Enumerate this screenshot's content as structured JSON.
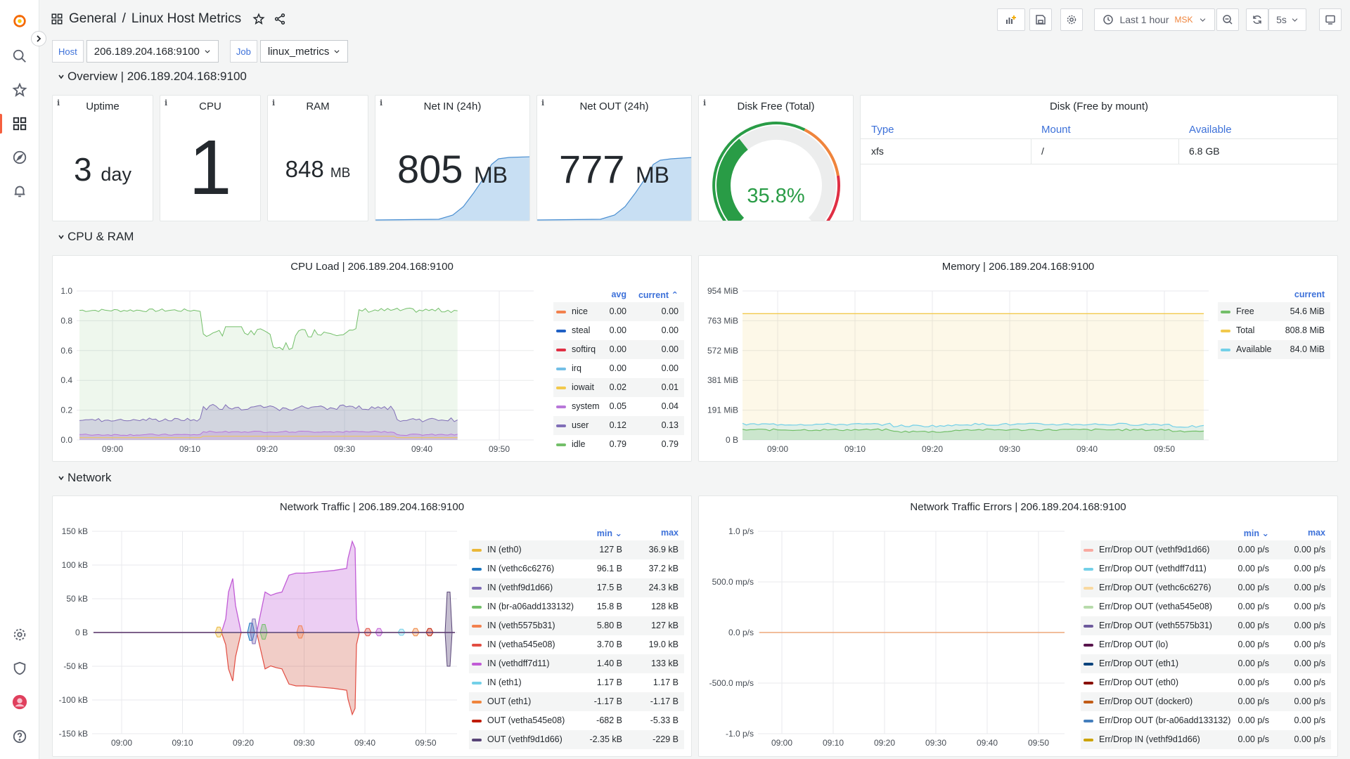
{
  "breadcrumb": {
    "folder": "General",
    "separator": "/",
    "dashboard": "Linux Host Metrics"
  },
  "toolbar": {
    "time_range": "Last 1 hour",
    "timezone": "MSK",
    "refresh_interval": "5s"
  },
  "variables": [
    {
      "label": "Host",
      "value": "206.189.204.168:9100"
    },
    {
      "label": "Job",
      "value": "linux_metrics"
    }
  ],
  "rows": {
    "overview": "Overview | 206.189.204.168:9100",
    "cpu_ram": "CPU & RAM",
    "network": "Network"
  },
  "stats": {
    "uptime": {
      "title": "Uptime",
      "value": "3",
      "unit": "day"
    },
    "cpu": {
      "title": "CPU",
      "value": "1"
    },
    "ram": {
      "title": "RAM",
      "value": "848",
      "unit": "MB"
    },
    "net_in": {
      "title": "Net IN (24h)",
      "value": "805",
      "unit": "MB"
    },
    "net_out": {
      "title": "Net OUT (24h)",
      "value": "777",
      "unit": "MB"
    },
    "disk_free": {
      "title": "Disk Free (Total)",
      "value": "35.8%",
      "fraction": 0.358,
      "color": "#299c46"
    }
  },
  "disk_table": {
    "title": "Disk (Free by mount)",
    "headers": [
      "Type",
      "Mount",
      "Available"
    ],
    "rows": [
      [
        "xfs",
        "/",
        "6.8 GB"
      ]
    ]
  },
  "chart_data": [
    {
      "id": "cpu",
      "type": "area",
      "title": "CPU Load | 206.189.204.168:9100",
      "x": [
        "09:00",
        "09:10",
        "09:20",
        "09:30",
        "09:40",
        "09:50"
      ],
      "yticks": [
        "0.0",
        "0.2",
        "0.4",
        "0.6",
        "0.8",
        "1.0"
      ],
      "ylim": [
        0,
        1
      ],
      "legend_headers": [
        "avg",
        "current"
      ],
      "series": [
        {
          "name": "nice",
          "color": "#f2814e",
          "avg": "0.00",
          "current": "0.00"
        },
        {
          "name": "steal",
          "color": "#1f60c4",
          "avg": "0.00",
          "current": "0.00"
        },
        {
          "name": "softirq",
          "color": "#e02f44",
          "avg": "0.00",
          "current": "0.00"
        },
        {
          "name": "irq",
          "color": "#73bfe6",
          "avg": "0.00",
          "current": "0.00"
        },
        {
          "name": "iowait",
          "color": "#f2c94c",
          "avg": "0.02",
          "current": "0.01"
        },
        {
          "name": "system",
          "color": "#b877d9",
          "avg": "0.05",
          "current": "0.04"
        },
        {
          "name": "user",
          "color": "#806eb7",
          "avg": "0.12",
          "current": "0.13"
        },
        {
          "name": "idle",
          "color": "#73bf69",
          "avg": "0.79",
          "current": "0.79"
        }
      ]
    },
    {
      "id": "mem",
      "type": "area",
      "title": "Memory | 206.189.204.168:9100",
      "x": [
        "09:00",
        "09:10",
        "09:20",
        "09:30",
        "09:40",
        "09:50"
      ],
      "yticks": [
        "0 B",
        "191 MiB",
        "381 MiB",
        "572 MiB",
        "763 MiB",
        "954 MiB"
      ],
      "legend_headers": [
        "current"
      ],
      "series": [
        {
          "name": "Free",
          "color": "#73bf69",
          "current": "54.6 MiB"
        },
        {
          "name": "Total",
          "color": "#f2c94c",
          "current": "808.8 MiB"
        },
        {
          "name": "Available",
          "color": "#73d0e8",
          "current": "84.0 MiB"
        }
      ]
    },
    {
      "id": "net",
      "type": "area",
      "title": "Network Traffic | 206.189.204.168:9100",
      "x": [
        "09:00",
        "09:10",
        "09:20",
        "09:30",
        "09:40",
        "09:50"
      ],
      "yticks": [
        "-150 kB",
        "-100 kB",
        "-50 kB",
        "0 B",
        "50 kB",
        "100 kB",
        "150 kB"
      ],
      "legend_headers": [
        "min",
        "max"
      ],
      "series": [
        {
          "name": "IN (eth0)",
          "color": "#eab839",
          "min": "127 B",
          "max": "36.9 kB"
        },
        {
          "name": "IN (vethc6c6276)",
          "color": "#1f78c1",
          "min": "96.1 B",
          "max": "37.2 kB"
        },
        {
          "name": "IN (vethf9d1d66)",
          "color": "#806eb7",
          "min": "17.5 B",
          "max": "24.3 kB"
        },
        {
          "name": "IN (br-a06add133132)",
          "color": "#73bf69",
          "min": "15.8 B",
          "max": "128 kB"
        },
        {
          "name": "IN (veth5575b31)",
          "color": "#f2814e",
          "min": "5.80 B",
          "max": "127 kB"
        },
        {
          "name": "IN (vetha545e08)",
          "color": "#e24d42",
          "min": "3.70 B",
          "max": "19.0 kB"
        },
        {
          "name": "IN (vethdff7d11)",
          "color": "#c15cd6",
          "min": "1.40 B",
          "max": "133 kB"
        },
        {
          "name": "IN (eth1)",
          "color": "#73d0e8",
          "min": "1.17 B",
          "max": "1.17 B"
        },
        {
          "name": "OUT (eth1)",
          "color": "#ef843c",
          "min": "-1.17 B",
          "max": "-1.17 B"
        },
        {
          "name": "OUT (vetha545e08)",
          "color": "#bf1b00",
          "min": "-682 B",
          "max": "-5.33 B"
        },
        {
          "name": "OUT (vethf9d1d66)",
          "color": "#584477",
          "min": "-2.35 kB",
          "max": "-229 B"
        }
      ]
    },
    {
      "id": "err",
      "type": "line",
      "title": "Network Traffic Errors | 206.189.204.168:9100",
      "x": [
        "09:00",
        "09:10",
        "09:20",
        "09:30",
        "09:40",
        "09:50"
      ],
      "yticks": [
        "-1.0 p/s",
        "-500.0 mp/s",
        "0.0 p/s",
        "500.0 mp/s",
        "1.0 p/s"
      ],
      "legend_headers": [
        "min",
        "max"
      ],
      "series": [
        {
          "name": "Err/Drop OUT (vethf9d1d66)",
          "color": "#f9a9a0",
          "min": "0.00 p/s",
          "max": "0.00 p/s"
        },
        {
          "name": "Err/Drop OUT (vethdff7d11)",
          "color": "#73d0e8",
          "min": "0.00 p/s",
          "max": "0.00 p/s"
        },
        {
          "name": "Err/Drop OUT (vethc6c6276)",
          "color": "#f9d9a0",
          "min": "0.00 p/s",
          "max": "0.00 p/s"
        },
        {
          "name": "Err/Drop OUT (vetha545e08)",
          "color": "#b7dbab",
          "min": "0.00 p/s",
          "max": "0.00 p/s"
        },
        {
          "name": "Err/Drop OUT (veth5575b31)",
          "color": "#6d5a9c",
          "min": "0.00 p/s",
          "max": "0.00 p/s"
        },
        {
          "name": "Err/Drop OUT (lo)",
          "color": "#58144c",
          "min": "0.00 p/s",
          "max": "0.00 p/s"
        },
        {
          "name": "Err/Drop OUT (eth1)",
          "color": "#0a437c",
          "min": "0.00 p/s",
          "max": "0.00 p/s"
        },
        {
          "name": "Err/Drop OUT (eth0)",
          "color": "#890f02",
          "min": "0.00 p/s",
          "max": "0.00 p/s"
        },
        {
          "name": "Err/Drop OUT (docker0)",
          "color": "#c15c17",
          "min": "0.00 p/s",
          "max": "0.00 p/s"
        },
        {
          "name": "Err/Drop OUT (br-a06add133132)",
          "color": "#447ebc",
          "min": "0.00 p/s",
          "max": "0.00 p/s"
        },
        {
          "name": "Err/Drop IN (vethf9d1d66)",
          "color": "#cca300",
          "min": "0.00 p/s",
          "max": "0.00 p/s"
        }
      ]
    }
  ]
}
